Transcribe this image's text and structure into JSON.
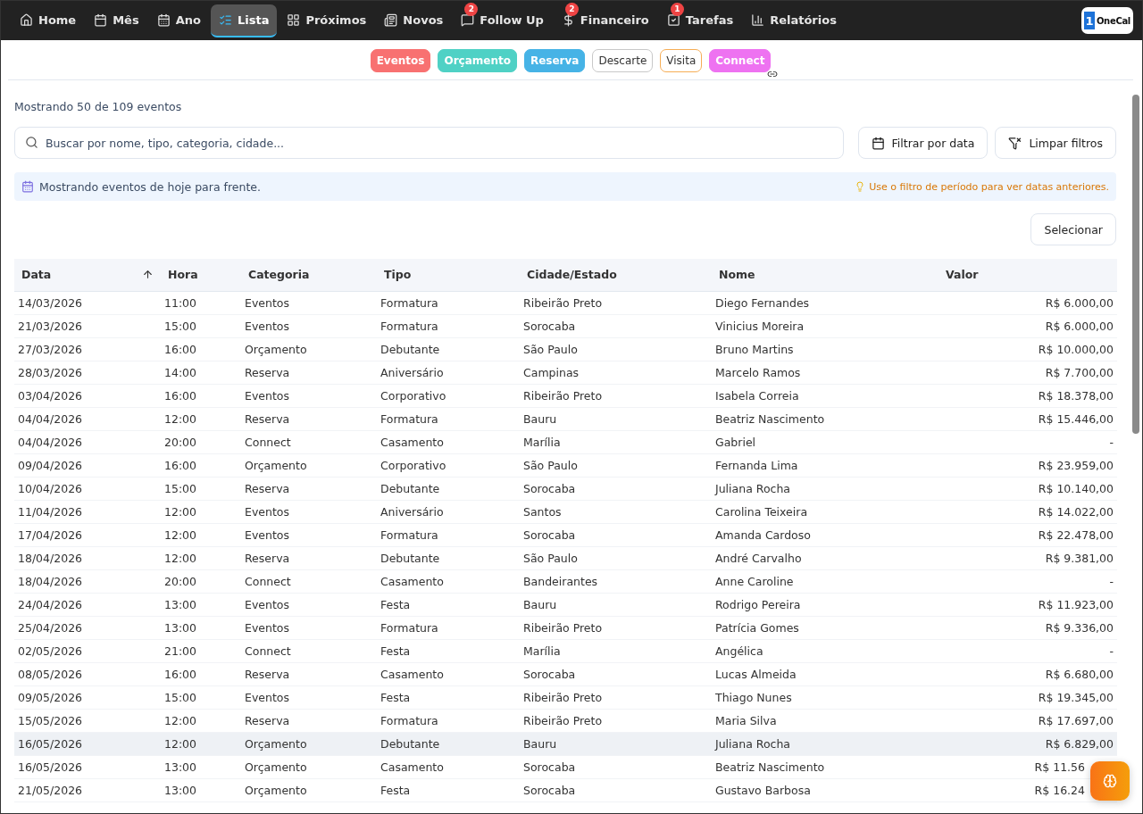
{
  "nav": {
    "items": [
      {
        "label": "Home",
        "selected": false
      },
      {
        "label": "Mês",
        "selected": false
      },
      {
        "label": "Ano",
        "selected": false
      },
      {
        "label": "Lista",
        "selected": true
      },
      {
        "label": "Próximos",
        "selected": false
      },
      {
        "label": "Novos",
        "selected": false
      },
      {
        "label": "Follow Up",
        "selected": false,
        "badge": "2"
      },
      {
        "label": "Financeiro",
        "selected": false,
        "badge": "2"
      },
      {
        "label": "Tarefas",
        "selected": false,
        "badge": "1"
      },
      {
        "label": "Relatórios",
        "selected": false
      }
    ],
    "logo": {
      "mark": "1",
      "name": "OneCal"
    }
  },
  "category_chips": [
    {
      "label": "Eventos",
      "kind": "filled",
      "color": "#f87171"
    },
    {
      "label": "Orçamento",
      "kind": "filled",
      "color": "#4fd1c5"
    },
    {
      "label": "Reserva",
      "kind": "filled",
      "color": "#46b3e6"
    },
    {
      "label": "Descarte",
      "kind": "outline",
      "color": "#c8c8c8"
    },
    {
      "label": "Visita",
      "kind": "outline",
      "color": "#f6ad55"
    },
    {
      "label": "Connect",
      "kind": "filled",
      "color": "#ee72f1",
      "linked": true
    }
  ],
  "count_text": "Mostrando 50 de 109 eventos",
  "search": {
    "placeholder": "Buscar por nome, tipo, categoria, cidade..."
  },
  "buttons": {
    "filter_date": "Filtrar por data",
    "clear_filters": "Limpar filtros",
    "select": "Selecionar"
  },
  "info_bar": {
    "text": "Mostrando eventos de hoje para frente.",
    "hint": "Use o filtro de período para ver datas anteriores."
  },
  "table": {
    "columns": [
      {
        "label": "Data",
        "sorted": true
      },
      {
        "label": "Hora",
        "sorted": false
      },
      {
        "label": "Categoria",
        "sorted": false
      },
      {
        "label": "Tipo",
        "sorted": false
      },
      {
        "label": "Cidade/Estado",
        "sorted": false
      },
      {
        "label": "Nome",
        "sorted": false
      },
      {
        "label": "Valor",
        "sorted": false
      }
    ],
    "rows": [
      {
        "cells": [
          "14/03/2026",
          "11:00",
          "Eventos",
          "Formatura",
          "Ribeirão Preto",
          "Diego Fernandes",
          "R$ 6.000,00"
        ],
        "hovered": false
      },
      {
        "cells": [
          "21/03/2026",
          "15:00",
          "Eventos",
          "Formatura",
          "Sorocaba",
          "Vinicius Moreira",
          "R$ 6.000,00"
        ],
        "hovered": false
      },
      {
        "cells": [
          "27/03/2026",
          "16:00",
          "Orçamento",
          "Debutante",
          "São Paulo",
          "Bruno Martins",
          "R$ 10.000,00"
        ],
        "hovered": false
      },
      {
        "cells": [
          "28/03/2026",
          "14:00",
          "Reserva",
          "Aniversário",
          "Campinas",
          "Marcelo Ramos",
          "R$ 7.700,00"
        ],
        "hovered": false
      },
      {
        "cells": [
          "03/04/2026",
          "16:00",
          "Eventos",
          "Corporativo",
          "Ribeirão Preto",
          "Isabela Correia",
          "R$ 18.378,00"
        ],
        "hovered": false
      },
      {
        "cells": [
          "04/04/2026",
          "12:00",
          "Reserva",
          "Formatura",
          "Bauru",
          "Beatriz Nascimento",
          "R$ 15.446,00"
        ],
        "hovered": false
      },
      {
        "cells": [
          "04/04/2026",
          "20:00",
          "Connect",
          "Casamento",
          "Marília",
          "Gabriel",
          "-"
        ],
        "hovered": false
      },
      {
        "cells": [
          "09/04/2026",
          "16:00",
          "Orçamento",
          "Corporativo",
          "São Paulo",
          "Fernanda Lima",
          "R$ 23.959,00"
        ],
        "hovered": false
      },
      {
        "cells": [
          "10/04/2026",
          "15:00",
          "Reserva",
          "Debutante",
          "Sorocaba",
          "Juliana Rocha",
          "R$ 10.140,00"
        ],
        "hovered": false
      },
      {
        "cells": [
          "11/04/2026",
          "12:00",
          "Eventos",
          "Aniversário",
          "Santos",
          "Carolina Teixeira",
          "R$ 14.022,00"
        ],
        "hovered": false
      },
      {
        "cells": [
          "17/04/2026",
          "12:00",
          "Eventos",
          "Formatura",
          "Sorocaba",
          "Amanda Cardoso",
          "R$ 22.478,00"
        ],
        "hovered": false
      },
      {
        "cells": [
          "18/04/2026",
          "12:00",
          "Reserva",
          "Debutante",
          "São Paulo",
          "André Carvalho",
          "R$ 9.381,00"
        ],
        "hovered": false
      },
      {
        "cells": [
          "18/04/2026",
          "20:00",
          "Connect",
          "Casamento",
          "Bandeirantes",
          "Anne Caroline",
          "-"
        ],
        "hovered": false
      },
      {
        "cells": [
          "24/04/2026",
          "13:00",
          "Eventos",
          "Festa",
          "Bauru",
          "Rodrigo Pereira",
          "R$ 11.923,00"
        ],
        "hovered": false
      },
      {
        "cells": [
          "25/04/2026",
          "13:00",
          "Eventos",
          "Formatura",
          "Ribeirão Preto",
          "Patrícia Gomes",
          "R$ 9.336,00"
        ],
        "hovered": false
      },
      {
        "cells": [
          "02/05/2026",
          "21:00",
          "Connect",
          "Festa",
          "Marília",
          "Angélica",
          "-"
        ],
        "hovered": false
      },
      {
        "cells": [
          "08/05/2026",
          "16:00",
          "Reserva",
          "Casamento",
          "Sorocaba",
          "Lucas Almeida",
          "R$ 6.680,00"
        ],
        "hovered": false
      },
      {
        "cells": [
          "09/05/2026",
          "15:00",
          "Eventos",
          "Festa",
          "Ribeirão Preto",
          "Thiago Nunes",
          "R$ 19.345,00"
        ],
        "hovered": false
      },
      {
        "cells": [
          "15/05/2026",
          "12:00",
          "Reserva",
          "Formatura",
          "Ribeirão Preto",
          "Maria Silva",
          "R$ 17.697,00"
        ],
        "hovered": false
      },
      {
        "cells": [
          "16/05/2026",
          "12:00",
          "Orçamento",
          "Debutante",
          "Bauru",
          "Juliana Rocha",
          "R$ 6.829,00"
        ],
        "hovered": true
      },
      {
        "cells": [
          "16/05/2026",
          "13:00",
          "Orçamento",
          "Casamento",
          "Sorocaba",
          "Beatriz Nascimento",
          "R$ 11.56"
        ],
        "hovered": false,
        "under_button": true
      },
      {
        "cells": [
          "21/05/2026",
          "13:00",
          "Orçamento",
          "Festa",
          "Sorocaba",
          "Gustavo Barbosa",
          "R$ 16.24"
        ],
        "hovered": false,
        "under_button": true
      }
    ]
  }
}
